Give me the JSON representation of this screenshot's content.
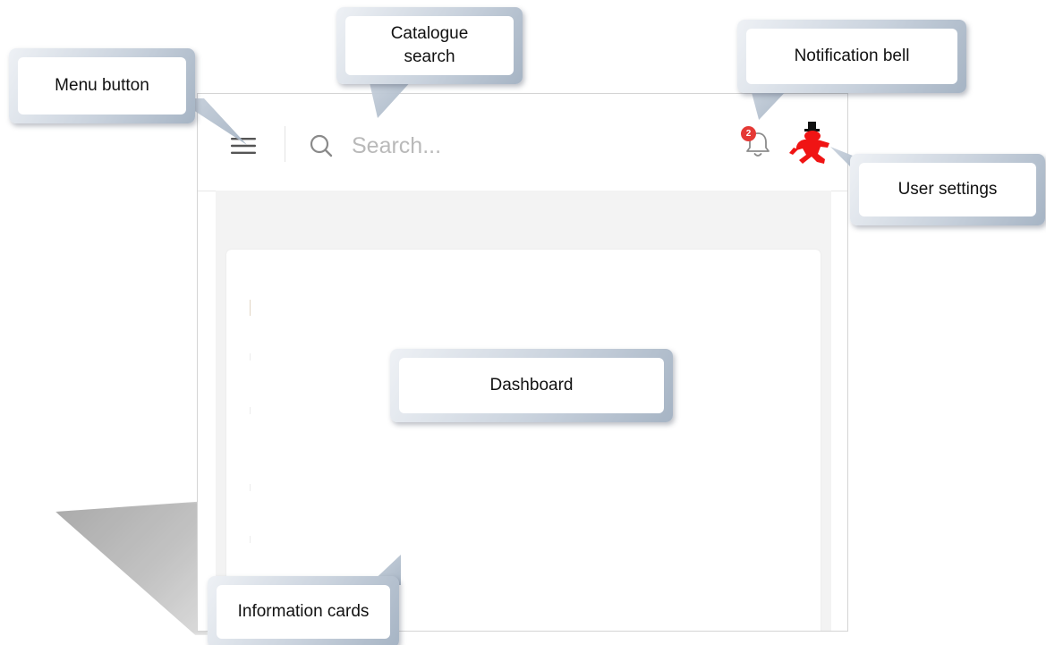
{
  "app": {
    "search": {
      "placeholder": "Search..."
    },
    "notifications": {
      "badge_count": "2"
    }
  },
  "annotations": {
    "menu_button": "Menu button",
    "catalogue_search": "Catalogue\nsearch",
    "notification_bell": "Notification bell",
    "user_settings": "User settings",
    "dashboard": "Dashboard",
    "information_cards": "Information cards"
  },
  "icons": {
    "menu": "hamburger-icon",
    "search": "search-icon",
    "notifications": "bell-icon",
    "user": "user-avatar-icon"
  },
  "colors": {
    "badge": "#e53935",
    "avatar": "#f01414",
    "callout_frame": "#a6b4c4"
  }
}
